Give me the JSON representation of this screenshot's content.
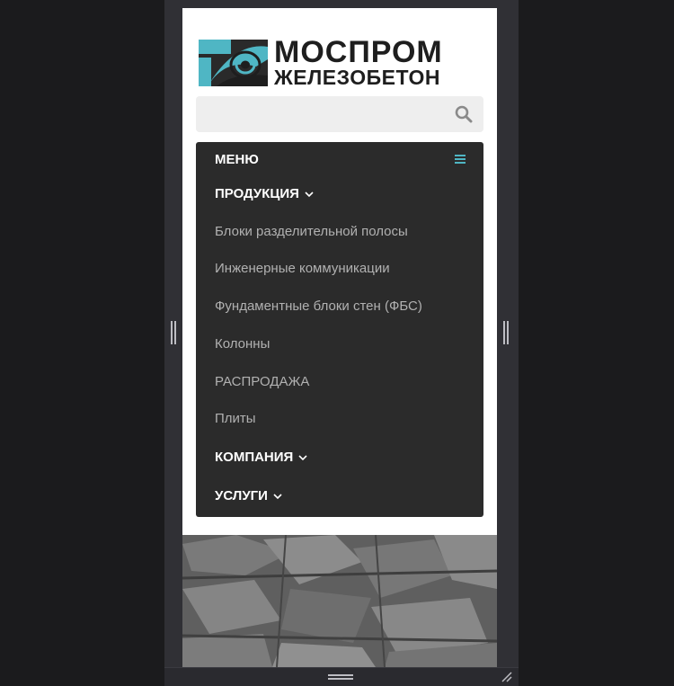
{
  "logo": {
    "line1": "МОСПРОМ",
    "line2": "ЖЕЛЕЗОБЕТОН"
  },
  "search": {
    "placeholder": ""
  },
  "menu": {
    "title": "МЕНЮ",
    "products": "ПРОДУКЦИЯ",
    "sub_items": [
      "Блоки разделительной полосы",
      "Инженерные коммуникации",
      "Фундаментные блоки стен (ФБС)",
      "Колонны",
      "РАСПРОДАЖА",
      "Плиты"
    ],
    "company": "КОМПАНИЯ",
    "services": "УСЛУГИ"
  },
  "colors": {
    "accent": "#4fb6c4",
    "menu_bg": "#2b2b2b",
    "sub_text": "#b1b1b1"
  }
}
